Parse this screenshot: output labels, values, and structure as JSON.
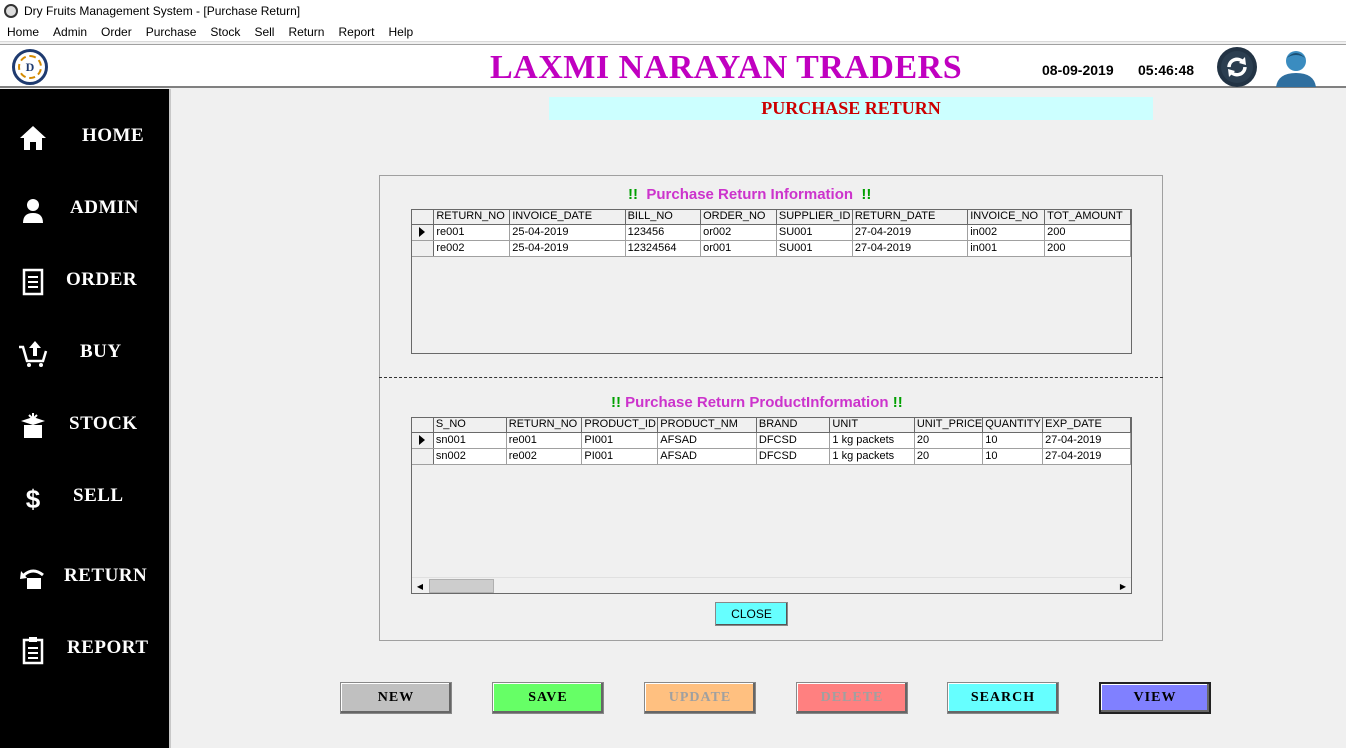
{
  "window": {
    "title": "Dry Fruits Management System - [Purchase Return]"
  },
  "menu": [
    "Home",
    "Admin",
    "Order",
    "Purchase",
    "Stock",
    "Sell",
    "Return",
    "Report",
    "Help"
  ],
  "header": {
    "company": "LAXMI NARAYAN TRADERS",
    "logo_letter": "D",
    "date": "08-09-2019",
    "time": "05:46:48"
  },
  "sidebar": {
    "items": [
      {
        "label": "HOME",
        "icon": "home-icon"
      },
      {
        "label": "ADMIN",
        "icon": "user-icon"
      },
      {
        "label": "ORDER",
        "icon": "document-icon"
      },
      {
        "label": "BUY",
        "icon": "cart-icon"
      },
      {
        "label": "STOCK",
        "icon": "box-icon"
      },
      {
        "label": "SELL",
        "icon": "dollar-icon"
      },
      {
        "label": "RETURN",
        "icon": "return-icon"
      },
      {
        "label": "REPORT",
        "icon": "clipboard-icon"
      }
    ]
  },
  "page": {
    "title": "PURCHASE RETURN"
  },
  "return_info": {
    "title": "Purchase Return Information",
    "bang": "!!",
    "columns": [
      "RETURN_NO",
      "INVOICE_DATE",
      "BILL_NO",
      "ORDER_NO",
      "SUPPLIER_ID",
      "RETURN_DATE",
      "INVOICE_NO",
      "TOT_AMOUNT"
    ],
    "rows": [
      [
        "re001",
        "25-04-2019",
        "123456",
        "or002",
        "SU001",
        "27-04-2019",
        "in002",
        "200"
      ],
      [
        "re002",
        "25-04-2019",
        "12324564",
        "or001",
        "SU001",
        "27-04-2019",
        "in001",
        "200"
      ]
    ]
  },
  "product_info": {
    "title": "Purchase Return ProductInformation",
    "bang": "!!",
    "columns": [
      "S_NO",
      "RETURN_NO",
      "PRODUCT_ID",
      "PRODUCT_NM",
      "BRAND",
      "UNIT",
      "UNIT_PRICE",
      "QUANTITY",
      "EXP_DATE"
    ],
    "rows": [
      [
        "sn001",
        "re001",
        "PI001",
        "AFSAD",
        "DFCSD",
        "1 kg packets",
        "20",
        "10",
        "27-04-2019"
      ],
      [
        "sn002",
        "re002",
        "PI001",
        "AFSAD",
        "DFCSD",
        "1 kg packets",
        "20",
        "10",
        "27-04-2019"
      ]
    ]
  },
  "buttons": {
    "close": "CLOSE",
    "actions": [
      {
        "label": "NEW",
        "bg": "#c0c0c0",
        "fg": "#000000"
      },
      {
        "label": "SAVE",
        "bg": "#66ff66",
        "fg": "#000000"
      },
      {
        "label": "UPDATE",
        "bg": "#ffc080",
        "fg": "#a0a0a0"
      },
      {
        "label": "DELETE",
        "bg": "#ff8080",
        "fg": "#a0a0a0"
      },
      {
        "label": "SEARCH",
        "bg": "#66ffff",
        "fg": "#000000"
      },
      {
        "label": "VIEW",
        "bg": "#8080ff",
        "fg": "#000000"
      }
    ]
  },
  "colors": {
    "company": "#c000c0",
    "page_title": "#cc0000",
    "page_title_bg": "#ccffff",
    "section_title": "#cc33cc",
    "bang": "#00a000"
  }
}
